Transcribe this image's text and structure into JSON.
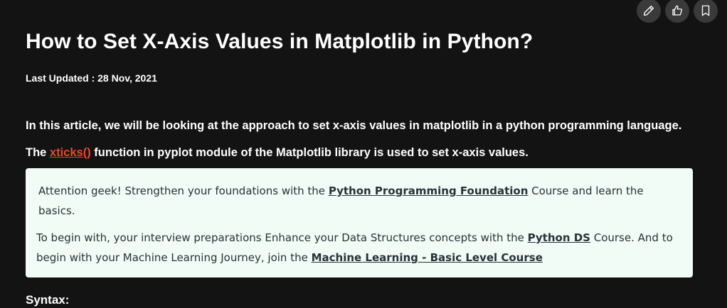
{
  "toolbar": {
    "icons": [
      "pencil-icon",
      "thumbs-up-icon",
      "bookmark-icon"
    ]
  },
  "article": {
    "title": "How to Set X-Axis Values in Matplotlib in Python?",
    "last_updated": "Last Updated : 28 Nov, 2021",
    "intro": "In this article, we will be looking at the approach to set x-axis values in matplotlib in a python programming language.",
    "para2_before": "The ",
    "para2_link": "xticks()",
    "para2_after": " function in pyplot module of the Matplotlib library is used to set x-axis values.",
    "syntax_heading": "Syntax:"
  },
  "notice": {
    "line1_before": "Attention geek! Strengthen your foundations with the ",
    "line1_link": "Python Programming Foundation",
    "line1_after": " Course and learn the basics.",
    "line2_before": "To begin with, your interview preparations Enhance your Data Structures concepts with the ",
    "line2_link1": "Python DS",
    "line2_middle": " Course. And to begin with your Machine Learning Journey, join the ",
    "line2_link2": "Machine Learning - Basic Level Course",
    "background": "#f1fcf6"
  },
  "colors": {
    "page_background": "#131313",
    "link_red": "#e8482b",
    "button_background": "#3a3a3a",
    "notice_text": "#273239"
  }
}
